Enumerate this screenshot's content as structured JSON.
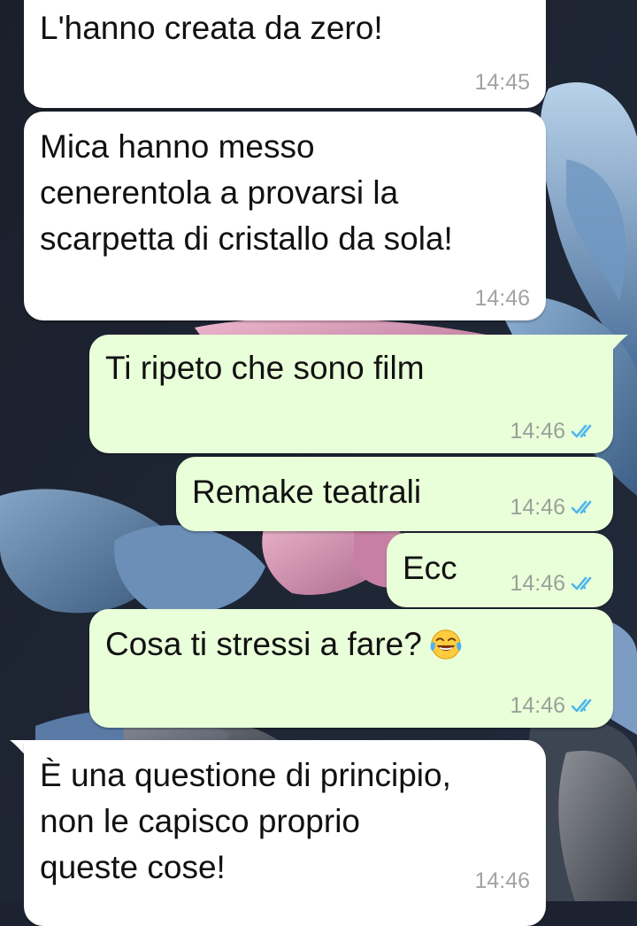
{
  "messages": [
    {
      "id": "m1",
      "direction": "incoming",
      "text": "L'hanno creata da zero!",
      "time": "14:45"
    },
    {
      "id": "m2",
      "direction": "incoming",
      "text": "Mica hanno messo\ncenerentola a provarsi la\nscarpetta di cristallo da sola!",
      "time": "14:46"
    },
    {
      "id": "m3",
      "direction": "outgoing",
      "text": "Ti ripeto che sono film",
      "time": "14:46",
      "status": "read"
    },
    {
      "id": "m4",
      "direction": "outgoing",
      "text": "Remake teatrali",
      "time": "14:46",
      "status": "read"
    },
    {
      "id": "m5",
      "direction": "outgoing",
      "text": "Ecc",
      "time": "14:46",
      "status": "read"
    },
    {
      "id": "m6",
      "direction": "outgoing",
      "text": "Cosa ti stressi a fare?",
      "emoji": "face-with-tears-of-joy",
      "time": "14:46",
      "status": "read"
    },
    {
      "id": "m7",
      "direction": "incoming",
      "text": "È una questione di principio,\nnon le capisco proprio\nqueste cose!",
      "time": "14:46"
    }
  ],
  "colors": {
    "incoming_bubble": "#ffffff",
    "outgoing_bubble": "#e9ffd9",
    "read_ticks": "#4fb6ec",
    "timestamp": "#9aa19a"
  },
  "icons": {
    "read_status": "double-check-icon",
    "emoji": "face-with-tears-of-joy-icon"
  }
}
